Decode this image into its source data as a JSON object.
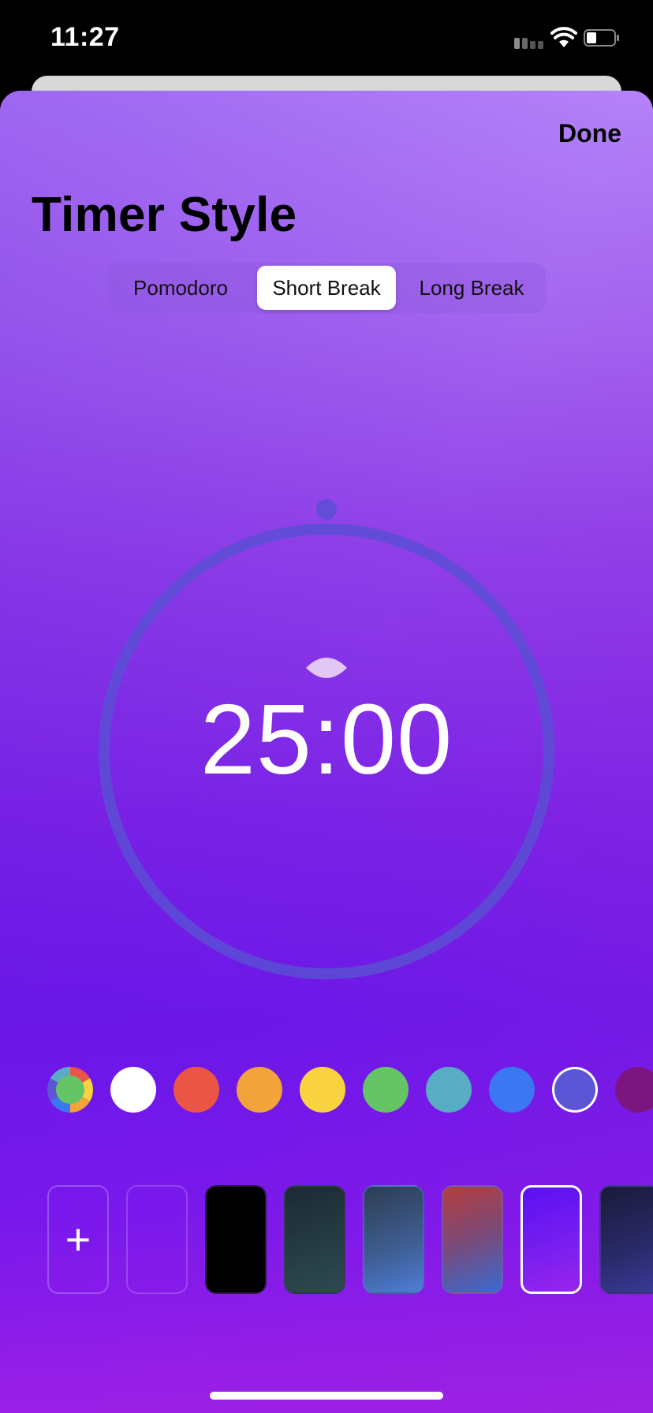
{
  "status_bar": {
    "time": "11:27"
  },
  "header": {
    "done_label": "Done",
    "title": "Timer Style"
  },
  "segmented_control": {
    "segments": [
      "Pomodoro",
      "Short Break",
      "Long Break"
    ],
    "selected": "Short Break"
  },
  "timer": {
    "value": "25:00",
    "ring_color": "#5a4fd4"
  },
  "color_swatches": {
    "colors": [
      "multicolor",
      "#ffffff",
      "#eb5545",
      "#f2a33a",
      "#f9d33f",
      "#64c466",
      "#58adc5",
      "#3a77f0",
      "#5b56d6",
      "#7b1680"
    ],
    "selected": "#5b56d6"
  },
  "background_tiles": {
    "add_label": "+",
    "selected_index": 6
  }
}
